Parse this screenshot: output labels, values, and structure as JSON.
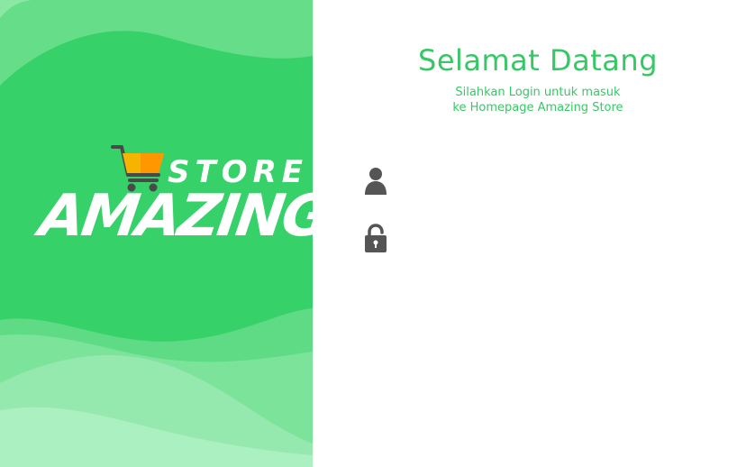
{
  "brand": {
    "logo_text_top": "STORE",
    "logo_text_main": "AMAZING",
    "primary_color": "#37d169",
    "text_color": "#37c866"
  },
  "welcome": {
    "title": "Selamat Datang",
    "subtitle": "Silahkan Login untuk masuk ke Homepage Amazing Store"
  },
  "form": {
    "username": {
      "value": "",
      "placeholder": "",
      "icon": "user-icon"
    },
    "password": {
      "value": "",
      "placeholder": "",
      "icon": "lock-icon"
    }
  }
}
